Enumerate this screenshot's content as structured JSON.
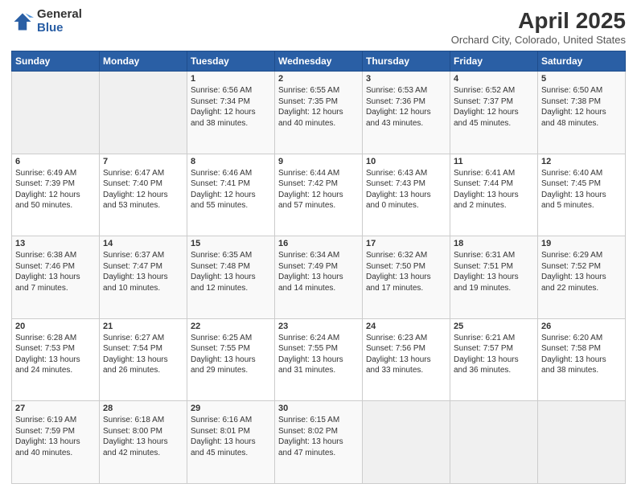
{
  "logo": {
    "general": "General",
    "blue": "Blue"
  },
  "title": "April 2025",
  "location": "Orchard City, Colorado, United States",
  "weekdays": [
    "Sunday",
    "Monday",
    "Tuesday",
    "Wednesday",
    "Thursday",
    "Friday",
    "Saturday"
  ],
  "weeks": [
    [
      {
        "day": "",
        "info": ""
      },
      {
        "day": "",
        "info": ""
      },
      {
        "day": "1",
        "info": "Sunrise: 6:56 AM\nSunset: 7:34 PM\nDaylight: 12 hours and 38 minutes."
      },
      {
        "day": "2",
        "info": "Sunrise: 6:55 AM\nSunset: 7:35 PM\nDaylight: 12 hours and 40 minutes."
      },
      {
        "day": "3",
        "info": "Sunrise: 6:53 AM\nSunset: 7:36 PM\nDaylight: 12 hours and 43 minutes."
      },
      {
        "day": "4",
        "info": "Sunrise: 6:52 AM\nSunset: 7:37 PM\nDaylight: 12 hours and 45 minutes."
      },
      {
        "day": "5",
        "info": "Sunrise: 6:50 AM\nSunset: 7:38 PM\nDaylight: 12 hours and 48 minutes."
      }
    ],
    [
      {
        "day": "6",
        "info": "Sunrise: 6:49 AM\nSunset: 7:39 PM\nDaylight: 12 hours and 50 minutes."
      },
      {
        "day": "7",
        "info": "Sunrise: 6:47 AM\nSunset: 7:40 PM\nDaylight: 12 hours and 53 minutes."
      },
      {
        "day": "8",
        "info": "Sunrise: 6:46 AM\nSunset: 7:41 PM\nDaylight: 12 hours and 55 minutes."
      },
      {
        "day": "9",
        "info": "Sunrise: 6:44 AM\nSunset: 7:42 PM\nDaylight: 12 hours and 57 minutes."
      },
      {
        "day": "10",
        "info": "Sunrise: 6:43 AM\nSunset: 7:43 PM\nDaylight: 13 hours and 0 minutes."
      },
      {
        "day": "11",
        "info": "Sunrise: 6:41 AM\nSunset: 7:44 PM\nDaylight: 13 hours and 2 minutes."
      },
      {
        "day": "12",
        "info": "Sunrise: 6:40 AM\nSunset: 7:45 PM\nDaylight: 13 hours and 5 minutes."
      }
    ],
    [
      {
        "day": "13",
        "info": "Sunrise: 6:38 AM\nSunset: 7:46 PM\nDaylight: 13 hours and 7 minutes."
      },
      {
        "day": "14",
        "info": "Sunrise: 6:37 AM\nSunset: 7:47 PM\nDaylight: 13 hours and 10 minutes."
      },
      {
        "day": "15",
        "info": "Sunrise: 6:35 AM\nSunset: 7:48 PM\nDaylight: 13 hours and 12 minutes."
      },
      {
        "day": "16",
        "info": "Sunrise: 6:34 AM\nSunset: 7:49 PM\nDaylight: 13 hours and 14 minutes."
      },
      {
        "day": "17",
        "info": "Sunrise: 6:32 AM\nSunset: 7:50 PM\nDaylight: 13 hours and 17 minutes."
      },
      {
        "day": "18",
        "info": "Sunrise: 6:31 AM\nSunset: 7:51 PM\nDaylight: 13 hours and 19 minutes."
      },
      {
        "day": "19",
        "info": "Sunrise: 6:29 AM\nSunset: 7:52 PM\nDaylight: 13 hours and 22 minutes."
      }
    ],
    [
      {
        "day": "20",
        "info": "Sunrise: 6:28 AM\nSunset: 7:53 PM\nDaylight: 13 hours and 24 minutes."
      },
      {
        "day": "21",
        "info": "Sunrise: 6:27 AM\nSunset: 7:54 PM\nDaylight: 13 hours and 26 minutes."
      },
      {
        "day": "22",
        "info": "Sunrise: 6:25 AM\nSunset: 7:55 PM\nDaylight: 13 hours and 29 minutes."
      },
      {
        "day": "23",
        "info": "Sunrise: 6:24 AM\nSunset: 7:55 PM\nDaylight: 13 hours and 31 minutes."
      },
      {
        "day": "24",
        "info": "Sunrise: 6:23 AM\nSunset: 7:56 PM\nDaylight: 13 hours and 33 minutes."
      },
      {
        "day": "25",
        "info": "Sunrise: 6:21 AM\nSunset: 7:57 PM\nDaylight: 13 hours and 36 minutes."
      },
      {
        "day": "26",
        "info": "Sunrise: 6:20 AM\nSunset: 7:58 PM\nDaylight: 13 hours and 38 minutes."
      }
    ],
    [
      {
        "day": "27",
        "info": "Sunrise: 6:19 AM\nSunset: 7:59 PM\nDaylight: 13 hours and 40 minutes."
      },
      {
        "day": "28",
        "info": "Sunrise: 6:18 AM\nSunset: 8:00 PM\nDaylight: 13 hours and 42 minutes."
      },
      {
        "day": "29",
        "info": "Sunrise: 6:16 AM\nSunset: 8:01 PM\nDaylight: 13 hours and 45 minutes."
      },
      {
        "day": "30",
        "info": "Sunrise: 6:15 AM\nSunset: 8:02 PM\nDaylight: 13 hours and 47 minutes."
      },
      {
        "day": "",
        "info": ""
      },
      {
        "day": "",
        "info": ""
      },
      {
        "day": "",
        "info": ""
      }
    ]
  ]
}
